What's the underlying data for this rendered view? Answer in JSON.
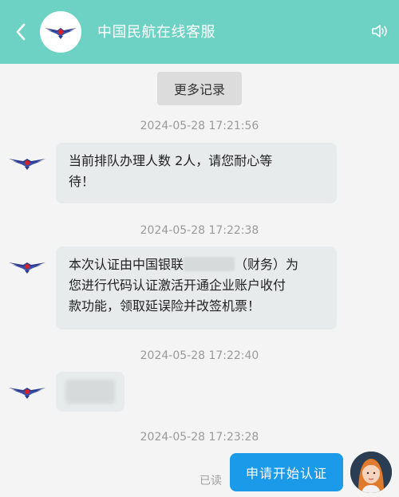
{
  "header": {
    "title": "中国民航在线客服",
    "back_icon": "chevron-left-icon",
    "logo": "caac-logo",
    "speaker_icon": "speaker-icon"
  },
  "history": {
    "more_label": "更多记录"
  },
  "messages": [
    {
      "time": "2024-05-28 17:21:56",
      "line1": "当前排队办理人数 2人，请您耐心等",
      "line2": "待！"
    },
    {
      "time": "2024-05-28 17:22:38",
      "line1a": "本次认证由中国银联",
      "line1b": "（财务）为",
      "line2": "您进行代码认证激活开通企业账户收付",
      "line3": "款功能，领取延误险并改签机票！"
    },
    {
      "time": "2024-05-28 17:22:40"
    },
    {
      "time": "2024-05-28 17:23:28",
      "read": "已读",
      "user_text": "申请开始认证"
    }
  ],
  "colors": {
    "header": "#6dd2c4",
    "user_bubble": "#1a9ae8",
    "agent_bubble": "#e7ebeb"
  }
}
